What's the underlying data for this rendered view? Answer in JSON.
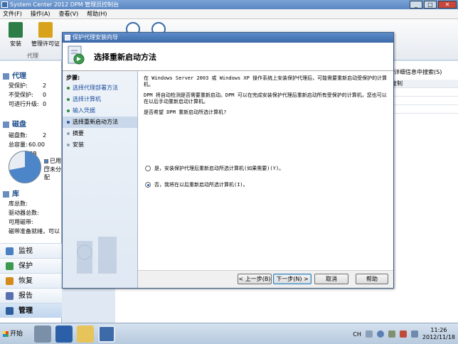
{
  "window": {
    "title": "System Center 2012 DPM 管理员控制台"
  },
  "menu": [
    "文件(F)",
    "操作(A)",
    "查看(V)",
    "帮助(H)"
  ],
  "ribbon": {
    "buttons": [
      {
        "label": "安装",
        "icon": "install-icon",
        "color": "#2d7d46"
      },
      {
        "label": "管理许可证",
        "icon": "license-icon",
        "color": "#d9a21b"
      }
    ],
    "group_label": "代理"
  },
  "leftnav": {
    "agents": {
      "title": "代理",
      "rows": [
        {
          "k": "受保护:",
          "v": "2"
        },
        {
          "k": "不受保护:",
          "v": "0"
        },
        {
          "k": "可进行升级:",
          "v": "0"
        }
      ]
    },
    "disks": {
      "title": "磁盘",
      "rows": [
        {
          "k": "磁盘数:",
          "v": "2"
        },
        {
          "k": "总容量:",
          "v": "60.00 GB"
        }
      ],
      "legend": [
        "已用空",
        "未分配"
      ]
    },
    "libraries": {
      "title": "库",
      "rows": [
        "库总数:",
        "驱动器总数:",
        "可用磁带:",
        "磁带准备就绪，可以"
      ]
    },
    "nav": [
      {
        "label": "监视",
        "icon": "monitor-icon",
        "color": "#4a7fc1"
      },
      {
        "label": "保护",
        "icon": "protect-icon",
        "color": "#3c9a4e"
      },
      {
        "label": "恢复",
        "icon": "recover-icon",
        "color": "#d68a1c"
      },
      {
        "label": "报告",
        "icon": "report-icon",
        "color": "#5a6fae"
      },
      {
        "label": "管理",
        "icon": "manage-icon",
        "color": "#2f5e9e"
      }
    ]
  },
  "background_pane": {
    "search_label": "详细信息中搜索(S)",
    "col_header": "复制"
  },
  "dialog": {
    "title": "保护代理安装向导",
    "header": "选择重新启动方法",
    "steps_title": "步骤:",
    "steps": [
      {
        "label": "选择代理部署方法",
        "state": "done"
      },
      {
        "label": "选择计算机",
        "state": "done"
      },
      {
        "label": "输入凭据",
        "state": "done"
      },
      {
        "label": "选择重新启动方法",
        "state": "current"
      },
      {
        "label": "摘要",
        "state": "future"
      },
      {
        "label": "安装",
        "state": "future"
      }
    ],
    "para1": "在 Windows Server 2003 或 Windows XP 操作系统上安装保护代理后，可能需要重新启动受保护的计算机。",
    "para2": "DPM 将自动检测是否需要重新启动。DPM 可以在完成安装保护代理后重新启动所有受保护的计算机，您也可以在以后手动重新启动计算机。",
    "question": "是否希望 DPM 重新启动所选计算机?",
    "options": [
      {
        "label": "是，安装保护代理后重新启动所选计算机(如果需要)(Y)。",
        "selected": false
      },
      {
        "label": "否，我将在以后重新启动所选计算机(I)。",
        "selected": true
      }
    ],
    "buttons": {
      "back": "< 上一步(B)",
      "next": "下一步(N) >",
      "cancel": "取消",
      "help": "帮助"
    }
  },
  "taskbar": {
    "start": "开始",
    "tray": {
      "lang": "CH",
      "time": "11:26",
      "date": "2012/11/18"
    }
  }
}
